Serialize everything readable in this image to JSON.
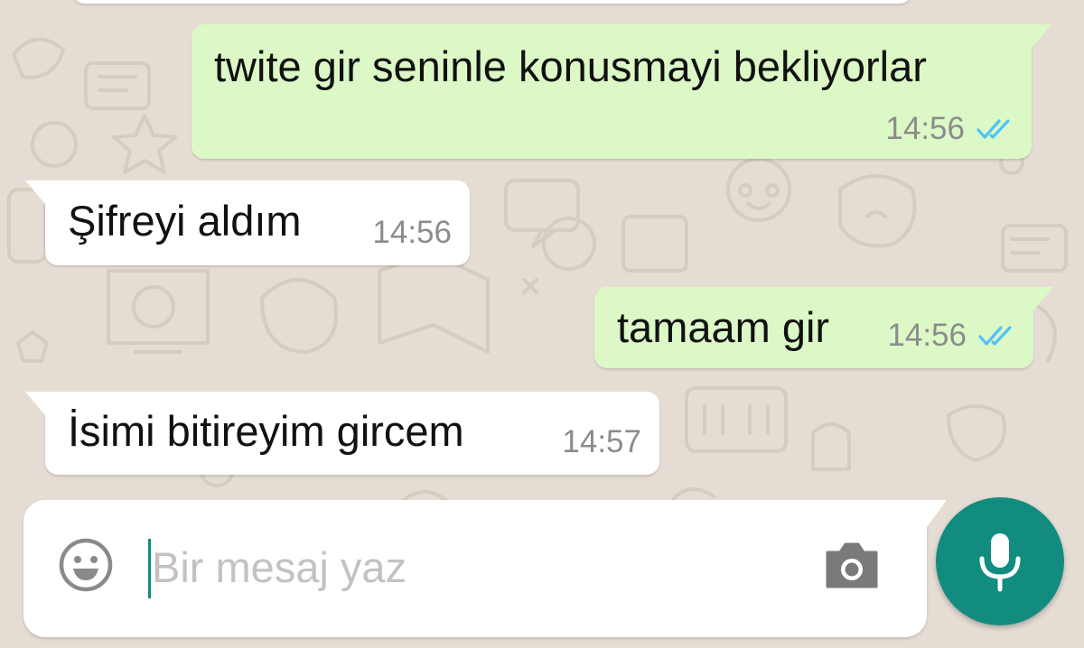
{
  "colors": {
    "wallpaper": "#e5ddd4",
    "outgoing_bubble": "#dcf8c6",
    "incoming_bubble": "#ffffff",
    "read_ticks": "#4fc3f7",
    "accent": "#128c7e"
  },
  "messages": [
    {
      "direction": "outgoing",
      "text": "twite gir seninle konusmayi bekliyorlar",
      "time": "14:56",
      "status": "read"
    },
    {
      "direction": "incoming",
      "text": "Şifreyi aldım",
      "time": "14:56"
    },
    {
      "direction": "outgoing",
      "text": "tamaam gir",
      "time": "14:56",
      "status": "read"
    },
    {
      "direction": "incoming",
      "text": "İsimi bitireyim gircem",
      "time": "14:57"
    }
  ],
  "composer": {
    "placeholder": "Bir mesaj yaz",
    "value": "",
    "emoji_icon": "smiley-icon",
    "camera_icon": "camera-icon"
  },
  "mic_button": {
    "icon": "microphone-icon"
  }
}
